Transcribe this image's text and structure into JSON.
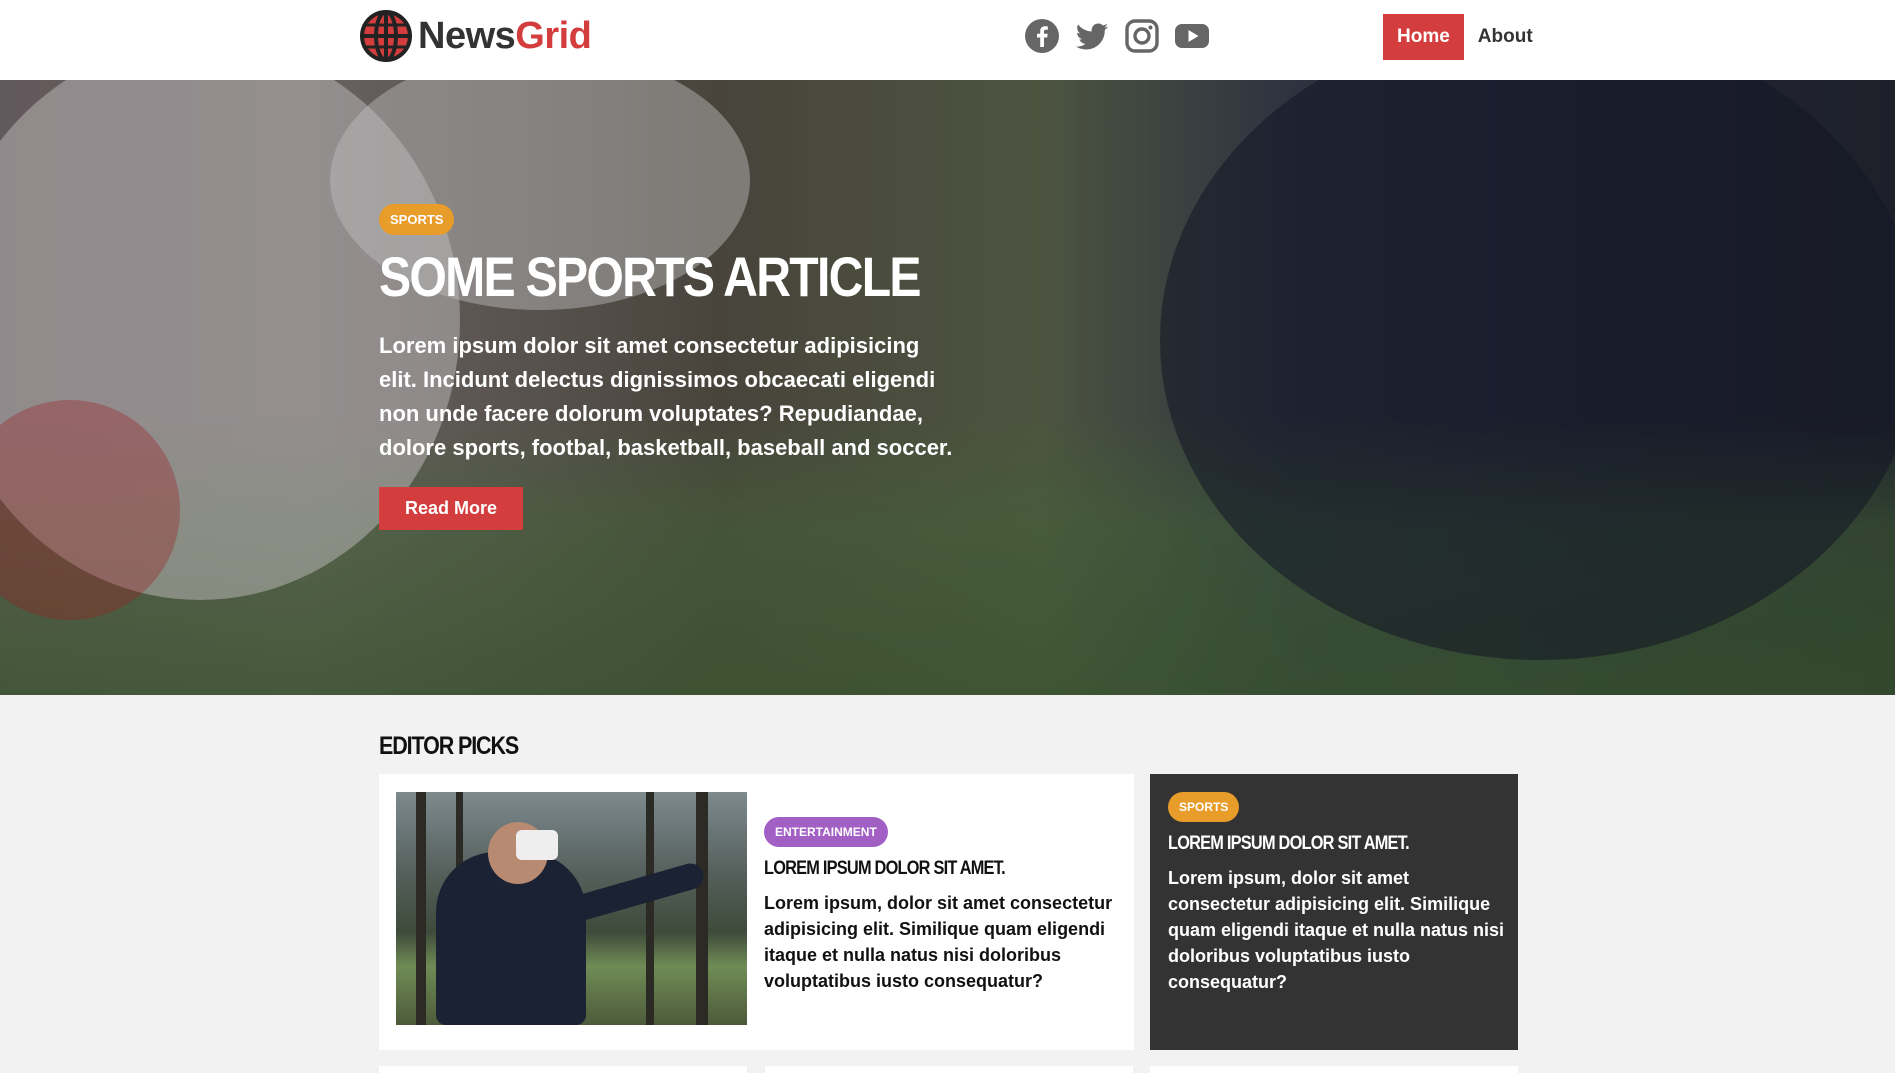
{
  "brand": {
    "name_part1": "News",
    "name_part2": "Grid",
    "accent": "#d43d3d"
  },
  "socials": [
    {
      "icon": "facebook-icon"
    },
    {
      "icon": "twitter-icon"
    },
    {
      "icon": "instagram-icon"
    },
    {
      "icon": "youtube-icon"
    }
  ],
  "nav": {
    "home": "Home",
    "about": "About"
  },
  "hero": {
    "tag": "Sports",
    "title": "Some Sports Article",
    "text": "Lorem ipsum dolor sit amet consectetur adipisicing elit. Incidunt delectus dignissimos obcaecati eligendi non unde facere dolorum voluptates? Repudiandae, dolore sports, footbal, basketball, baseball and soccer.",
    "button": "Read More"
  },
  "editor_picks": {
    "heading": "Editor Picks",
    "main_card": {
      "tag": "Entertainment",
      "title": "Lorem ipsum dolor sit amet.",
      "text": "Lorem ipsum, dolor sit amet consectetur adipisicing elit. Similique quam eligendi itaque et nulla natus nisi doloribus voluptatibus iusto consequatur?"
    },
    "side_card": {
      "tag": "Sports",
      "title": "Lorem ipsum dolor sit amet.",
      "text": "Lorem ipsum, dolor sit amet consectetur adipisicing elit. Similique quam eligendi itaque et nulla natus nisi doloribus voluptatibus iusto consequatur?"
    }
  },
  "colors": {
    "sports_tag": "#e89c2a",
    "entertainment_tag": "#a25fc4",
    "dark_card": "#333333"
  }
}
